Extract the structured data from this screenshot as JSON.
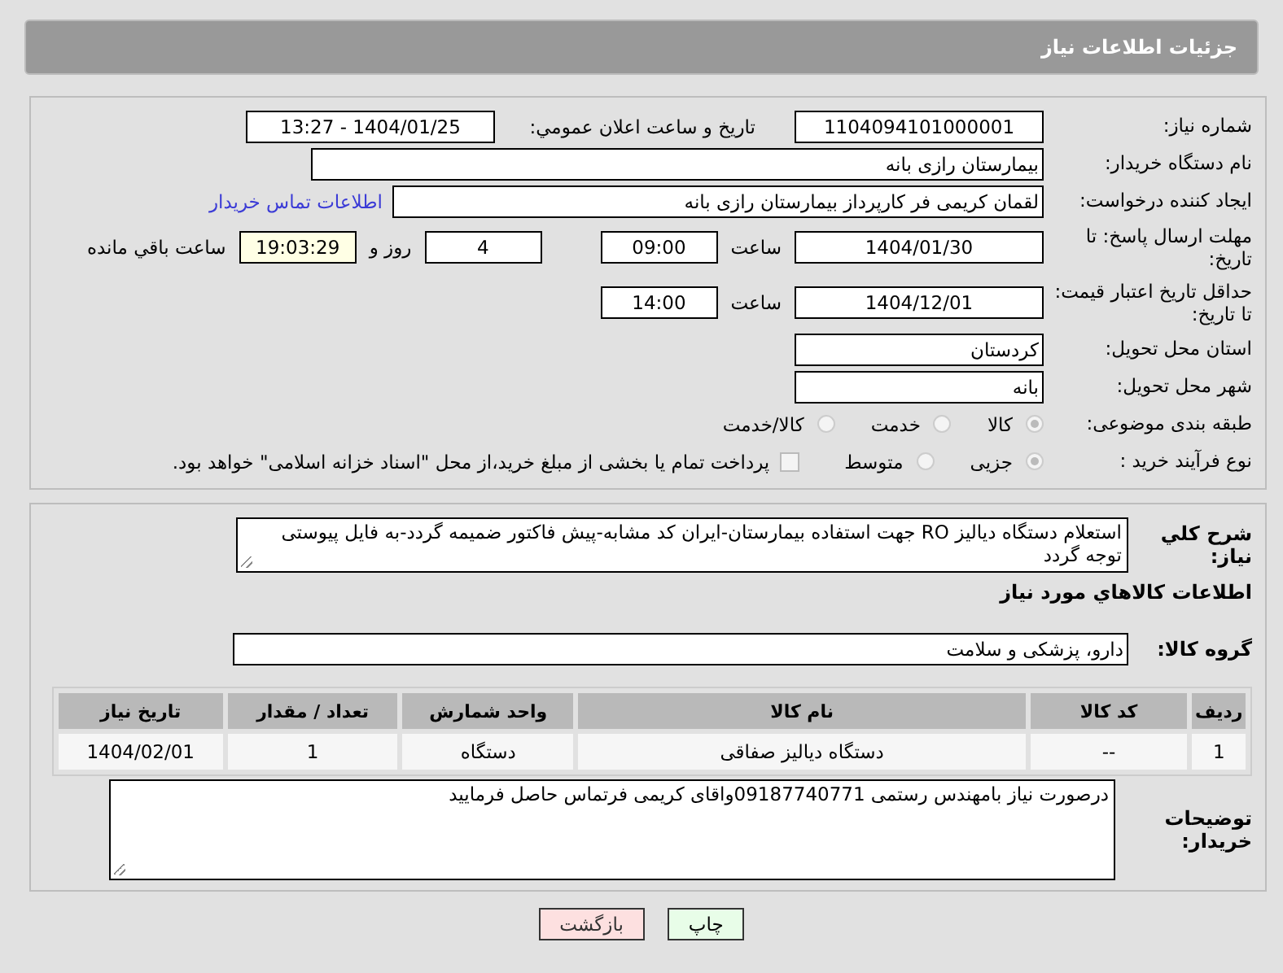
{
  "header": {
    "title": "جزئیات اطلاعات نیاز"
  },
  "need_number": {
    "label": "شماره نیاز:",
    "value": "1104094101000001"
  },
  "announce": {
    "label": "تاریخ و ساعت اعلان عمومي:",
    "value": "1404/01/25 - 13:27"
  },
  "buyer_org": {
    "label": "نام دستگاه خريدار:",
    "value": "بیمارستان رازی بانه"
  },
  "creator": {
    "label": "ایجاد کننده درخواست:",
    "value": "لقمان کریمی فر کارپرداز بیمارستان رازی بانه",
    "link": "اطلاعات تماس خریدار"
  },
  "deadline": {
    "label": "مهلت ارسال پاسخ: تا تاریخ:",
    "date": "1404/01/30",
    "time_label": "ساعت",
    "time": "09:00",
    "days": "4",
    "days_label": "روز و",
    "remaining": "19:03:29",
    "remaining_label": "ساعت باقي مانده"
  },
  "validity": {
    "label": "حداقل تاریخ اعتبار قیمت: تا تاریخ:",
    "date": "1404/12/01",
    "time_label": "ساعت",
    "time": "14:00"
  },
  "province": {
    "label": "استان محل تحویل:",
    "value": "کردستان"
  },
  "city": {
    "label": "شهر محل تحویل:",
    "value": "بانه"
  },
  "category": {
    "label": "طبقه بندی موضوعی:",
    "options": [
      {
        "label": "کالا",
        "selected": true
      },
      {
        "label": "خدمت",
        "selected": false
      },
      {
        "label": "کالا/خدمت",
        "selected": false
      }
    ]
  },
  "process": {
    "label": "نوع فرآیند خرید :",
    "options": [
      {
        "label": "جزیی",
        "selected": true
      },
      {
        "label": "متوسط",
        "selected": false
      }
    ],
    "treasury": {
      "label": "پرداخت تمام یا بخشی از مبلغ خرید،از محل \"اسناد خزانه اسلامی\" خواهد بود.",
      "checked": false
    }
  },
  "description": {
    "label": "شرح کلي نياز:",
    "value": "استعلام دستگاه دیالیز RO جهت استفاده بیمارستان-ایران کد مشابه-پیش فاکتور ضمیمه گردد-به فایل پیوستی توجه گردد"
  },
  "goods_title": "اطلاعات کالاهاي مورد نياز",
  "goods_group": {
    "label": "گروه کالا:",
    "value": "دارو، پزشکی و سلامت"
  },
  "table": {
    "columns": [
      "ردیف",
      "کد کالا",
      "نام کالا",
      "واحد شمارش",
      "تعداد / مقدار",
      "تاریخ نیاز"
    ],
    "rows": [
      [
        "1",
        "--",
        "دستگاه دیالیز صفاقی",
        "دستگاه",
        "1",
        "1404/02/01"
      ]
    ]
  },
  "buyer_notes": {
    "label": "توضیحات خریدار:",
    "value": "درصورت نیاز بامهندس رستمی 09187740771واقای کریمی فرتماس حاصل فرمایید"
  },
  "buttons": [
    {
      "label": "چاپ",
      "kind": "print"
    },
    {
      "label": "بازگشت",
      "kind": "back"
    }
  ]
}
